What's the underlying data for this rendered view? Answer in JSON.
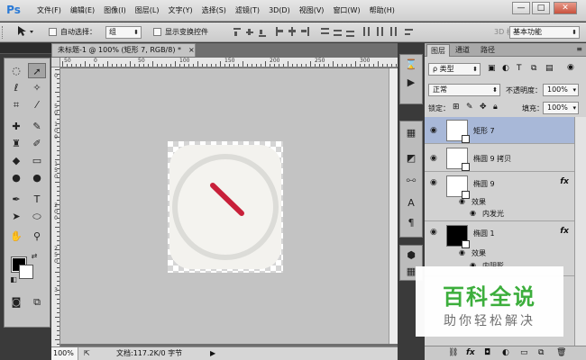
{
  "app": {
    "logo": "Ps"
  },
  "menu": [
    "文件(F)",
    "编辑(E)",
    "图像(I)",
    "图层(L)",
    "文字(Y)",
    "选择(S)",
    "滤镜(T)",
    "3D(D)",
    "视图(V)",
    "窗口(W)",
    "帮助(H)"
  ],
  "window_controls": {
    "minimize": "—",
    "maximize": "□",
    "close": "✕"
  },
  "options": {
    "auto_select_label": "自动选择：",
    "auto_select_value": "组",
    "show_transform_label": "显示变换控件",
    "mode_3d": "3D 模",
    "workspace": "基本功能"
  },
  "document": {
    "tab_title": "未标题-1 @ 100% (矩形 7, RGB/8) *",
    "tab_close": "×",
    "ruler_h": [
      "50",
      "0",
      "50",
      "100",
      "150",
      "200",
      "250",
      "300"
    ],
    "ruler_v": [
      "0",
      "5",
      "0",
      "1",
      "0",
      "0",
      "1",
      "5",
      "0",
      "2",
      "0",
      "0",
      "2",
      "5",
      "0",
      "3"
    ],
    "zoom": "100%",
    "doc_info": "文档:117.2K/0 字节"
  },
  "layers_panel": {
    "tabs": [
      "图层",
      "通道",
      "路径"
    ],
    "filter_kind": "ρ 类型",
    "blend_mode": "正常",
    "opacity_label": "不透明度：",
    "opacity_value": "100%",
    "lock_label": "锁定：",
    "fill_label": "填充：",
    "fill_value": "100%",
    "layers": [
      {
        "name": "矩形 7",
        "selected": true,
        "fx": ""
      },
      {
        "name": "椭圆 9 拷贝",
        "selected": false,
        "fx": ""
      },
      {
        "name": "椭圆 9",
        "selected": false,
        "fx": "fx",
        "effects_label": "效果",
        "effect": "内发光"
      },
      {
        "name": "椭圆 1",
        "selected": false,
        "fx": "fx",
        "effects_label": "效果",
        "effect": "内阴影"
      }
    ]
  },
  "watermark": {
    "title": "百科全说",
    "subtitle": "助你轻松解决"
  },
  "colors": {
    "selected_layer": "#a8b8d8",
    "needle": "#c8203a",
    "dial_face": "#f4f3ef",
    "watermark_green": "#3cae3c"
  }
}
